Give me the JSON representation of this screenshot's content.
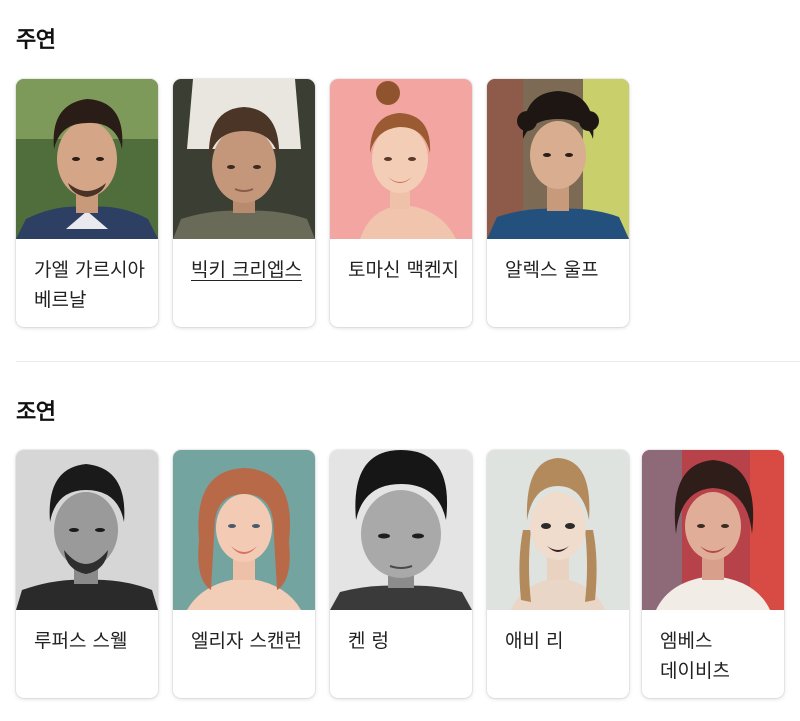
{
  "sections": {
    "lead": {
      "title": "주연",
      "cast": [
        {
          "name": "가엘 가르시아 베르날",
          "link": false
        },
        {
          "name": "빅키 크리엡스",
          "link": true
        },
        {
          "name": "토마신 맥켄지",
          "link": false
        },
        {
          "name": "알렉스 울프",
          "link": false
        }
      ]
    },
    "supporting": {
      "title": "조연",
      "cast": [
        {
          "name": "루퍼스 스웰",
          "link": false
        },
        {
          "name": "엘리자 스캔런",
          "link": false
        },
        {
          "name": "켄 렁",
          "link": false
        },
        {
          "name": "애비 리",
          "link": false
        },
        {
          "name": "엠베스 데이비츠",
          "link": false
        }
      ]
    }
  }
}
